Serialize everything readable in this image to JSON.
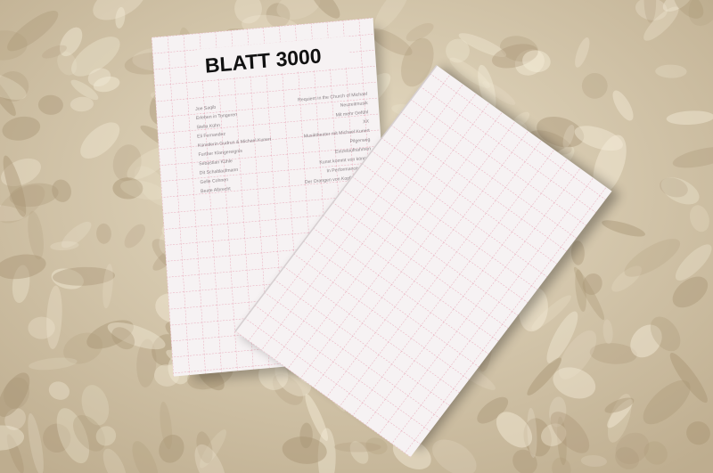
{
  "colors": {
    "fur_base": "#d9ccb0",
    "fur_light": "#f4ecd8",
    "fur_shadow": "#a89474",
    "paper": "#f6f2f3",
    "grid_line": "#e8a9b9",
    "title_ink": "#111111",
    "toc_ink": "#8a8286"
  },
  "magazine": {
    "title": "BLATT 3000",
    "toc_left": [
      "Joe Saqib",
      "Erleben in Tongeren",
      "Stella Kühn",
      "Eli Fernandez",
      "Künstlerin Gudrun & Michael Kunert",
      "Further Klangereignis",
      "Sebastian Kühle",
      "Dit Schaltlaufmann",
      "Gelle Cohnen",
      "Beate Albrecht"
    ],
    "toc_right": [
      "Requiem in the Church of Michael",
      "Neuzeitmusik",
      "Mit mehr Gefühl",
      "XX",
      "Musiktheater mit Michael Kunert",
      "Pilgerweg",
      "Einzelaufnahmen",
      "Kunst kommt von können",
      "In Performance Pflicht",
      "Der Orangen von Kopfangeboten"
    ]
  }
}
